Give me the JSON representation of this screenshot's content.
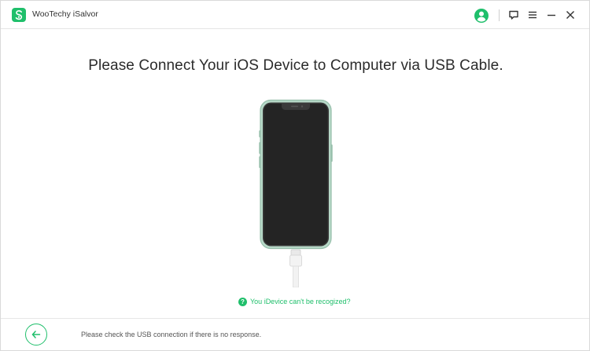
{
  "app": {
    "title": "WooTechy iSalvor",
    "logo_icon": "wootechy-logo-icon",
    "accent_color": "#1fbf6b"
  },
  "titlebar": {
    "account_icon": "user-account-icon",
    "feedback_icon": "feedback-icon",
    "menu_icon": "menu-icon",
    "minimize_icon": "minimize-icon",
    "close_icon": "close-icon"
  },
  "main": {
    "headline": "Please Connect Your iOS Device to Computer via USB Cable.",
    "help_link": "You iDevice can't be recogized?",
    "help_icon_glyph": "?"
  },
  "footer": {
    "back_icon": "arrow-left-icon",
    "message": "Please check the USB connection if there is no response."
  }
}
